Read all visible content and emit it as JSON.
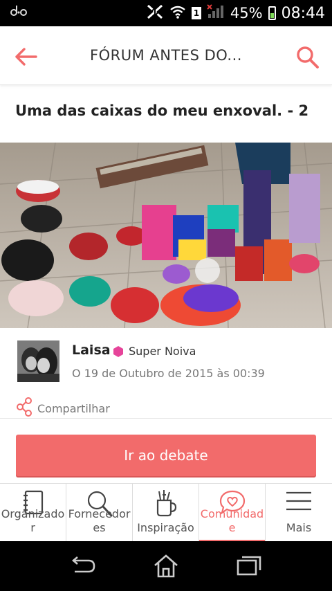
{
  "status_bar": {
    "battery": "45%",
    "time": "08:44",
    "sim_label": "1",
    "app_icon": "odo-icon"
  },
  "header": {
    "title": "FÓRUM ANTES DO...",
    "back_icon": "arrow-left-icon",
    "search_icon": "search-icon"
  },
  "post": {
    "title": "Uma das caixas do meu enxoval. - 2",
    "author": "Laisa",
    "badge": "Super Noiva",
    "date": "O 19 de Outubro de 2015 às 00:39",
    "share_label": "Compartilhar"
  },
  "debate_button": "Ir ao debate",
  "tabs": [
    {
      "label": "Organizador",
      "icon": "notebook-icon",
      "active": false
    },
    {
      "label": "Fornecedores",
      "icon": "magnifier-icon",
      "active": false
    },
    {
      "label": "Inspiração",
      "icon": "cup-icon",
      "active": false
    },
    {
      "label": "Comunidade",
      "icon": "heart-bubble-icon",
      "active": true
    },
    {
      "label": "Mais",
      "icon": "menu-icon",
      "active": false
    }
  ],
  "colors": {
    "accent": "#f26b6b",
    "text_dark": "#222222",
    "text_muted": "#777777"
  }
}
